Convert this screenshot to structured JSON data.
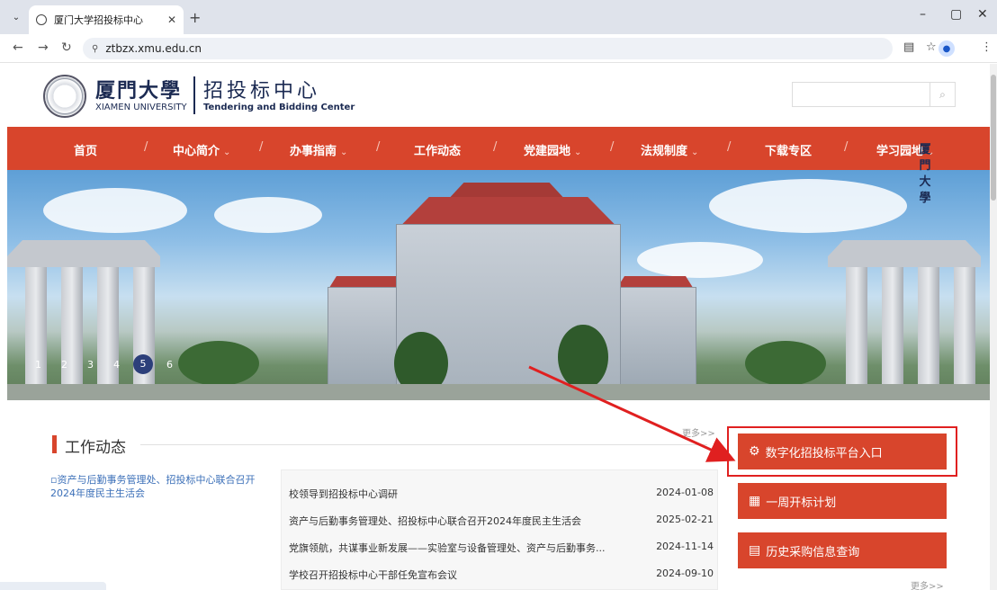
{
  "browser": {
    "tab_title": "厦门大学招投标中心",
    "url": "ztbzx.xmu.edu.cn"
  },
  "header": {
    "logo_cn": "厦門大學",
    "logo_en": "XIAMEN UNIVERSITY",
    "center_cn": "招投标中心",
    "center_en": "Tendering and Bidding Center",
    "search_placeholder": ""
  },
  "nav": {
    "items": [
      {
        "label": "首页",
        "caret": ""
      },
      {
        "label": "中心简介",
        "caret": "⌄"
      },
      {
        "label": "办事指南",
        "caret": "⌄"
      },
      {
        "label": "工作动态",
        "caret": ""
      },
      {
        "label": "党建园地",
        "caret": "⌄"
      },
      {
        "label": "法规制度",
        "caret": "⌄"
      },
      {
        "label": "下载专区",
        "caret": ""
      },
      {
        "label": "学习园地",
        "caret": "⌄"
      }
    ],
    "separator": "/"
  },
  "banner": {
    "gate_text": "厦門大學",
    "slides": [
      "1",
      "2",
      "3",
      "4",
      "5",
      "6"
    ],
    "active_slide": "5"
  },
  "news": {
    "section_title": "工作动态",
    "more_label": "更多>>",
    "image_alt": "资产与后勤事务管理处、招投标中心联合召开2024年度民主生活会",
    "items": [
      {
        "title": "校领导到招投标中心调研",
        "date": "2024-01-08"
      },
      {
        "title": "资产与后勤事务管理处、招投标中心联合召开2024年度民主生活会",
        "date": "2025-02-21"
      },
      {
        "title": "党旗领航，共谋事业新发展——实验室与设备管理处、资产与后勤事务...",
        "date": "2024-11-14"
      },
      {
        "title": "学校召开招投标中心干部任免宣布会议",
        "date": "2024-09-10"
      }
    ]
  },
  "side": {
    "buttons": [
      {
        "label": "数字化招投标平台入口",
        "icon": "⚙"
      },
      {
        "label": "一周开标计划",
        "icon": "▦"
      },
      {
        "label": "历史采购信息查询",
        "icon": "▤"
      }
    ],
    "more_label": "更多>>"
  },
  "colors": {
    "brand_red": "#d8452c",
    "navy": "#1b2a52",
    "highlight": "#e02020"
  }
}
